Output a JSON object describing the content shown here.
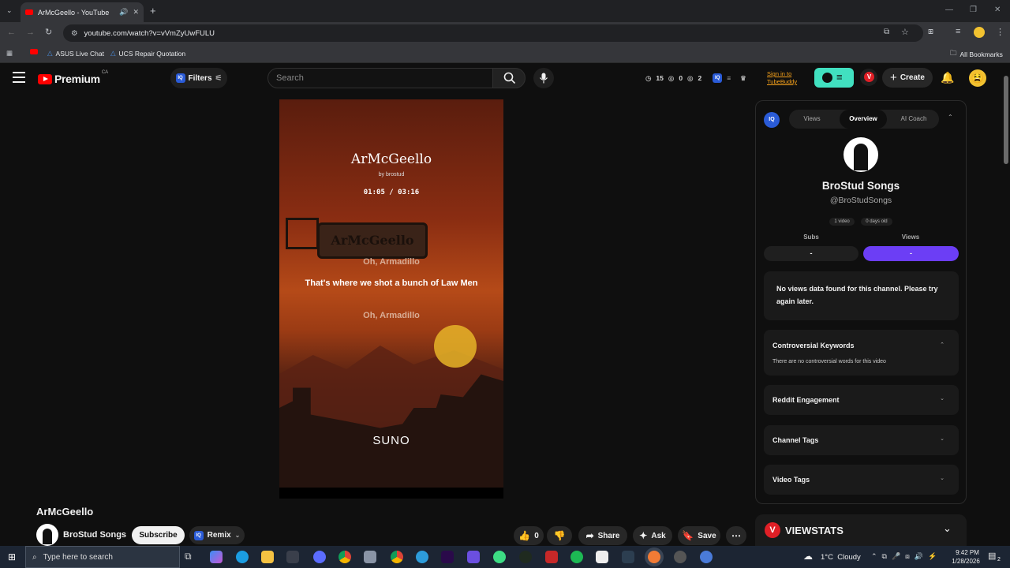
{
  "browser": {
    "tab_title": "ArMcGeello - YouTube",
    "new_tab": "+",
    "url": "youtube.com/watch?v=vVmZyUwFULU",
    "bookmarks": [
      "ASUS Live Chat",
      "UCS Repair Quotation"
    ],
    "all_bookmarks": "All Bookmarks"
  },
  "yt_header": {
    "logo_text": "Premium",
    "region": "CA",
    "filters_label": "Filters",
    "iq_label": "IQ",
    "search_placeholder": "Search",
    "stats": {
      "a": "15",
      "b": "0",
      "c": "2"
    },
    "signin_line1": "Sign in to",
    "signin_line2": "TubeBuddy",
    "vs_badge": "V",
    "create_label": "Create"
  },
  "video": {
    "song_title": "ArMcGeello",
    "by_line": "by brostud",
    "time": "01:05 / 03:16",
    "sign_text": "ArMcGeello",
    "lyric_prev": "Oh, Armadillo",
    "lyric_current": "That's where we shot a bunch of Law Men",
    "lyric_next": "Oh, Armadillo",
    "brand": "SUNO"
  },
  "video_info": {
    "title": "ArMcGeello",
    "channel": "BroStud Songs",
    "subscribe_label": "Subscribe",
    "remix_label": "Remix",
    "likes": "0",
    "share_label": "Share",
    "ask_label": "Ask",
    "save_label": "Save"
  },
  "panel": {
    "iq_label": "IQ",
    "tabs": [
      "Views",
      "Overview",
      "AI Coach"
    ],
    "active_tab": "Overview",
    "channel_name": "BroStud Songs",
    "handle": "@BroStudSongs",
    "video_count": "1 video",
    "age": "0 days old",
    "subs_label": "Subs",
    "views_label": "Views",
    "subs_value": "-",
    "views_value": "-",
    "no_data_msg": "No views data found for this channel. Please try again later.",
    "sections": [
      {
        "title": "Controversial Keywords",
        "body": "There are no controversial words for this video"
      },
      {
        "title": "Reddit Engagement"
      },
      {
        "title": "Channel Tags"
      },
      {
        "title": "Video Tags"
      }
    ]
  },
  "viewstats": {
    "title": "VIEWSTATS"
  },
  "taskbar": {
    "search_placeholder": "Type here to search",
    "weather": "1°C  Cloudy",
    "time": "9:42 PM",
    "date": "1/28/2026",
    "notif_count": "2"
  },
  "colors": {
    "youtube_red": "#ff0000",
    "tubebuddy": "#41e0c0",
    "views_purple": "#6c3ef5",
    "viewstats_red": "#e01f26"
  }
}
